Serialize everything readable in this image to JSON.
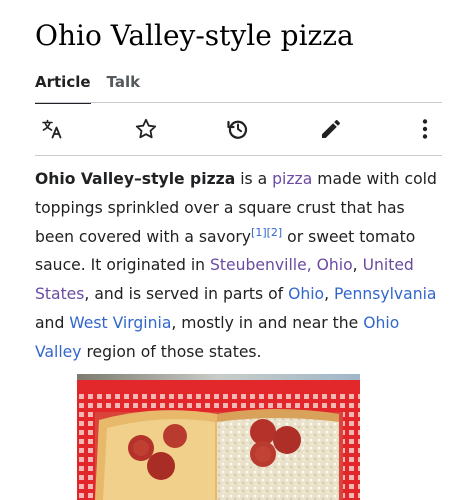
{
  "page": {
    "title": "Ohio Valley-style pizza"
  },
  "tabs": [
    {
      "label": "Article",
      "active": true
    },
    {
      "label": "Talk",
      "active": false
    }
  ],
  "toolbar": {
    "icons": [
      "language-icon",
      "star-icon",
      "history-icon",
      "edit-pencil-icon",
      "more-options-icon"
    ]
  },
  "lead": {
    "subject": "Ohio Valley–style pizza",
    "t1": " is a ",
    "pizza_link": "pizza",
    "t2": " made with cold toppings sprinkled over a square crust that has been covered with a savory",
    "ref1": "[1]",
    "ref2": "[2]",
    "t3": " or sweet tomato sauce. It originated in ",
    "steubenville_link": "Steubenville, Ohio",
    "t4": ", ",
    "united_states_link": "United States",
    "t5": ", and is served in parts of ",
    "ohio_link": "Ohio",
    "t6": ", ",
    "pennsylvania_link": "Pennsylvania",
    "t7": " and ",
    "west_virginia_link": "West Virginia",
    "t8": ", mostly in and near the ",
    "ohio_valley_link": "Ohio Valley",
    "t9": " region of those states."
  },
  "colors": {
    "link": "#3366cc",
    "visited_link": "#6b4ba1",
    "text": "#202122",
    "divider": "#c8ccd1"
  }
}
